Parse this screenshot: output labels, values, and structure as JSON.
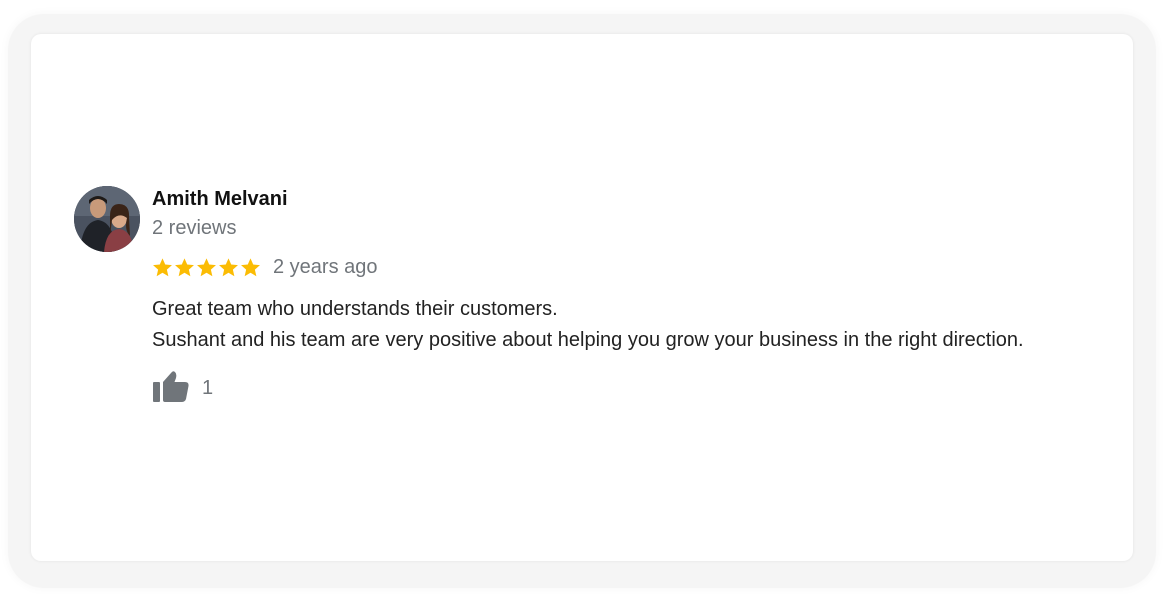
{
  "review": {
    "reviewer_name": "Amith Melvani",
    "review_count": "2 reviews",
    "rating": 5,
    "rating_max": 5,
    "time_ago": "2 years ago",
    "text_lines": [
      "Great team who understands their customers.",
      "Sushant and his team are very positive about helping you grow your business in the right direction."
    ],
    "like_count": "1"
  },
  "colors": {
    "star": "#fbbc04",
    "secondary_text": "#70757a",
    "like_icon": "#70757a"
  },
  "icons": {
    "avatar": "profile-photo",
    "like": "thumbs-up-icon",
    "star": "star-icon"
  }
}
